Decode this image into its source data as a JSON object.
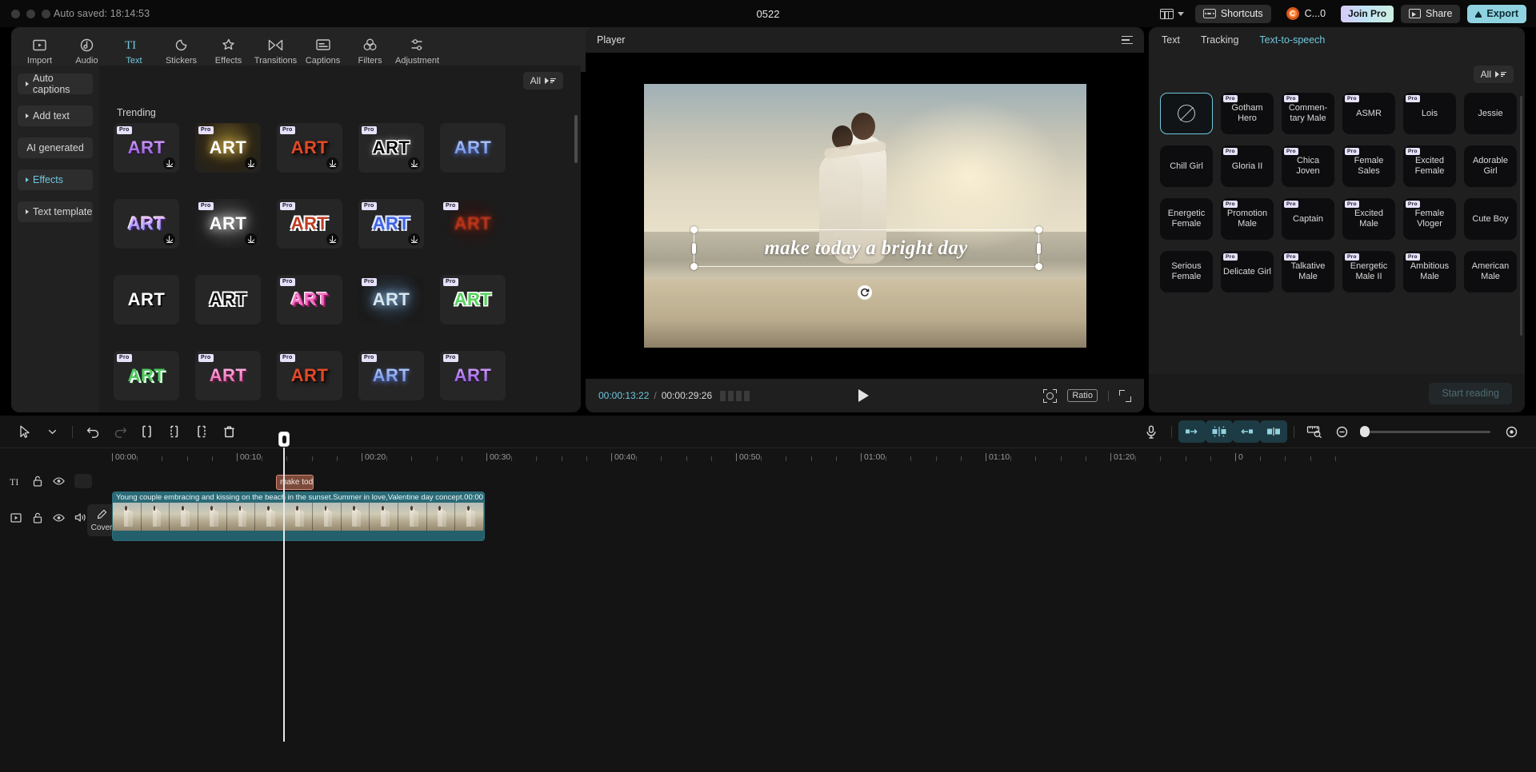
{
  "titlebar": {
    "autosave": "Auto saved: 18:14:53",
    "doc_title": "0522",
    "layout_icon": "layout-icon",
    "shortcuts_label": "Shortcuts",
    "account_label": "C...0",
    "account_initial": "C",
    "join_pro_label": "Join Pro",
    "share_label": "Share",
    "export_label": "Export"
  },
  "tool_tabs": [
    {
      "label": "Import",
      "icon": "import-icon",
      "active": false
    },
    {
      "label": "Audio",
      "icon": "audio-icon",
      "active": false
    },
    {
      "label": "Text",
      "icon": "text-icon",
      "active": true
    },
    {
      "label": "Stickers",
      "icon": "stickers-icon",
      "active": false
    },
    {
      "label": "Effects",
      "icon": "effects-icon",
      "active": false
    },
    {
      "label": "Transitions",
      "icon": "transitions-icon",
      "active": false
    },
    {
      "label": "Captions",
      "icon": "captions-icon",
      "active": false
    },
    {
      "label": "Filters",
      "icon": "filters-icon",
      "active": false
    },
    {
      "label": "Adjustment",
      "icon": "adjustment-icon",
      "active": false
    }
  ],
  "left_panel": {
    "nav": [
      {
        "label": "Auto captions",
        "expandable": true,
        "accent": false
      },
      {
        "label": "Add text",
        "expandable": true,
        "accent": false
      },
      {
        "label": "AI generated",
        "expandable": false,
        "accent": false
      },
      {
        "label": "Effects",
        "expandable": true,
        "accent": true
      },
      {
        "label": "Text template",
        "expandable": true,
        "accent": false
      }
    ],
    "filter_label": "All",
    "section_title": "Trending",
    "card_text": "ART",
    "cards": [
      {
        "pro": true,
        "style": "purple-grad",
        "download": true
      },
      {
        "pro": true,
        "style": "gold-glow",
        "download": true
      },
      {
        "pro": true,
        "style": "red-shadow",
        "download": true
      },
      {
        "pro": true,
        "style": "black-outline",
        "download": true
      },
      {
        "pro": false,
        "style": "blue-soft",
        "download": false
      },
      {
        "pro": false,
        "style": "violet-3d",
        "download": true
      },
      {
        "pro": true,
        "style": "white-glow",
        "download": true
      },
      {
        "pro": true,
        "style": "red-bubble",
        "download": true
      },
      {
        "pro": true,
        "style": "blue-bubble",
        "download": true
      },
      {
        "pro": true,
        "style": "red-blur",
        "download": false
      },
      {
        "pro": false,
        "style": "white-plain",
        "download": false
      },
      {
        "pro": false,
        "style": "black-ol2",
        "download": false
      },
      {
        "pro": true,
        "style": "pink-3d",
        "download": false
      },
      {
        "pro": true,
        "style": "ice-glow",
        "download": false
      },
      {
        "pro": true,
        "style": "green-ol",
        "download": false
      },
      {
        "pro": true,
        "style": "green-3d",
        "download": false
      },
      {
        "pro": true,
        "style": "pink-grad",
        "download": false
      },
      {
        "pro": true,
        "style": "red-shadow",
        "download": false
      },
      {
        "pro": true,
        "style": "blue-soft",
        "download": false
      },
      {
        "pro": true,
        "style": "purple-grad",
        "download": false
      }
    ]
  },
  "player": {
    "title": "Player",
    "menu_icon": "hamburger-icon",
    "overlay_text": "make today a bright day",
    "current_time": "00:00:13:22",
    "total_time": "00:00:29:26",
    "frames_icon": "frames-icon",
    "play_icon": "play-icon",
    "crop_icon": "crop-zoom-icon",
    "ratio_label": "Ratio",
    "fullscreen_icon": "fullscreen-icon",
    "rotate_icon": "rotate-handle-icon"
  },
  "right_panel": {
    "tabs": [
      {
        "label": "Text",
        "active": false
      },
      {
        "label": "Tracking",
        "active": false
      },
      {
        "label": "Text-to-speech",
        "active": true
      }
    ],
    "filter_label": "All",
    "start_reading_label": "Start reading",
    "voices": [
      {
        "label": "",
        "pro": false,
        "selected": true,
        "icon": "no-voice-icon"
      },
      {
        "label": "Gotham Hero",
        "pro": true,
        "selected": false
      },
      {
        "label": "Commen-tary Male",
        "pro": true,
        "selected": false
      },
      {
        "label": "ASMR",
        "pro": true,
        "selected": false
      },
      {
        "label": "Lois",
        "pro": true,
        "selected": false
      },
      {
        "label": "Jessie",
        "pro": false,
        "selected": false
      },
      {
        "label": "Chill Girl",
        "pro": false,
        "selected": false
      },
      {
        "label": "Gloria II",
        "pro": true,
        "selected": false
      },
      {
        "label": "Chica Joven",
        "pro": true,
        "selected": false
      },
      {
        "label": "Female Sales",
        "pro": true,
        "selected": false
      },
      {
        "label": "Excited Female",
        "pro": true,
        "selected": false
      },
      {
        "label": "Adorable Girl",
        "pro": false,
        "selected": false
      },
      {
        "label": "Energetic Female",
        "pro": false,
        "selected": false
      },
      {
        "label": "Promotion Male",
        "pro": true,
        "selected": false
      },
      {
        "label": "Captain",
        "pro": true,
        "selected": false
      },
      {
        "label": "Excited Male",
        "pro": true,
        "selected": false
      },
      {
        "label": "Female Vloger",
        "pro": true,
        "selected": false
      },
      {
        "label": "Cute Boy",
        "pro": false,
        "selected": false
      },
      {
        "label": "Serious Female",
        "pro": false,
        "selected": false
      },
      {
        "label": "Delicate Girl",
        "pro": true,
        "selected": false
      },
      {
        "label": "Talkative Male",
        "pro": true,
        "selected": false
      },
      {
        "label": "Energetic Male II",
        "pro": true,
        "selected": false
      },
      {
        "label": "Ambitious Male",
        "pro": true,
        "selected": false
      },
      {
        "label": "American Male",
        "pro": false,
        "selected": false
      }
    ]
  },
  "timeline": {
    "toolbar_left": [
      {
        "icon": "select-cursor-icon",
        "name": "select-tool"
      },
      {
        "icon": "chevron-down-icon",
        "name": "tool-dropdown"
      },
      {
        "icon": "undo-icon",
        "name": "undo-button"
      },
      {
        "icon": "redo-icon",
        "name": "redo-button"
      },
      {
        "icon": "split-left-icon",
        "name": "trim-left-button"
      },
      {
        "icon": "split-icon",
        "name": "split-button"
      },
      {
        "icon": "split-right-icon",
        "name": "trim-right-button"
      },
      {
        "icon": "trash-icon",
        "name": "delete-button"
      }
    ],
    "toolbar_right": [
      {
        "icon": "microphone-icon",
        "name": "record-voiceover-button"
      },
      {
        "icon": "keyframe-left-icon",
        "name": "keyframe-prev-button"
      },
      {
        "icon": "keyframe-center-icon",
        "name": "keyframe-add-button"
      },
      {
        "icon": "keyframe-right-icon",
        "name": "keyframe-next-button"
      },
      {
        "icon": "mirror-icon",
        "name": "mirror-button"
      },
      {
        "icon": "ruler-icon",
        "name": "timeline-ruler-button"
      },
      {
        "icon": "zoom-out-icon",
        "name": "zoom-out-button"
      },
      {
        "icon": "zoom-in-icon",
        "name": "zoom-fit-button"
      }
    ],
    "ruler_labels": [
      "00:00",
      "00:10",
      "00:20",
      "00:30",
      "00:40",
      "00:50",
      "01:00",
      "01:10",
      "01:20",
      "0"
    ],
    "playhead_time": "00:00:13:22",
    "text_track": {
      "icon": "text-track-icon",
      "lock_icon": "lock-icon",
      "eye_icon": "eye-icon",
      "clip_label": "make toda"
    },
    "video_track": {
      "icon": "video-track-icon",
      "lock_icon": "lock-icon",
      "eye_icon": "eye-icon",
      "mute_icon": "speaker-icon",
      "cover_label": "Cover",
      "cover_icon": "pencil-icon",
      "clip_title": "Young couple embracing and kissing on the beach in the sunset.Summer in love,Valentine day concept.",
      "clip_duration": "00:00"
    }
  },
  "colors": {
    "accent": "#6fc7de",
    "export_bg": "#8fd3e0",
    "clip_video": "#1b4f59",
    "clip_text": "#7b4a3a"
  }
}
